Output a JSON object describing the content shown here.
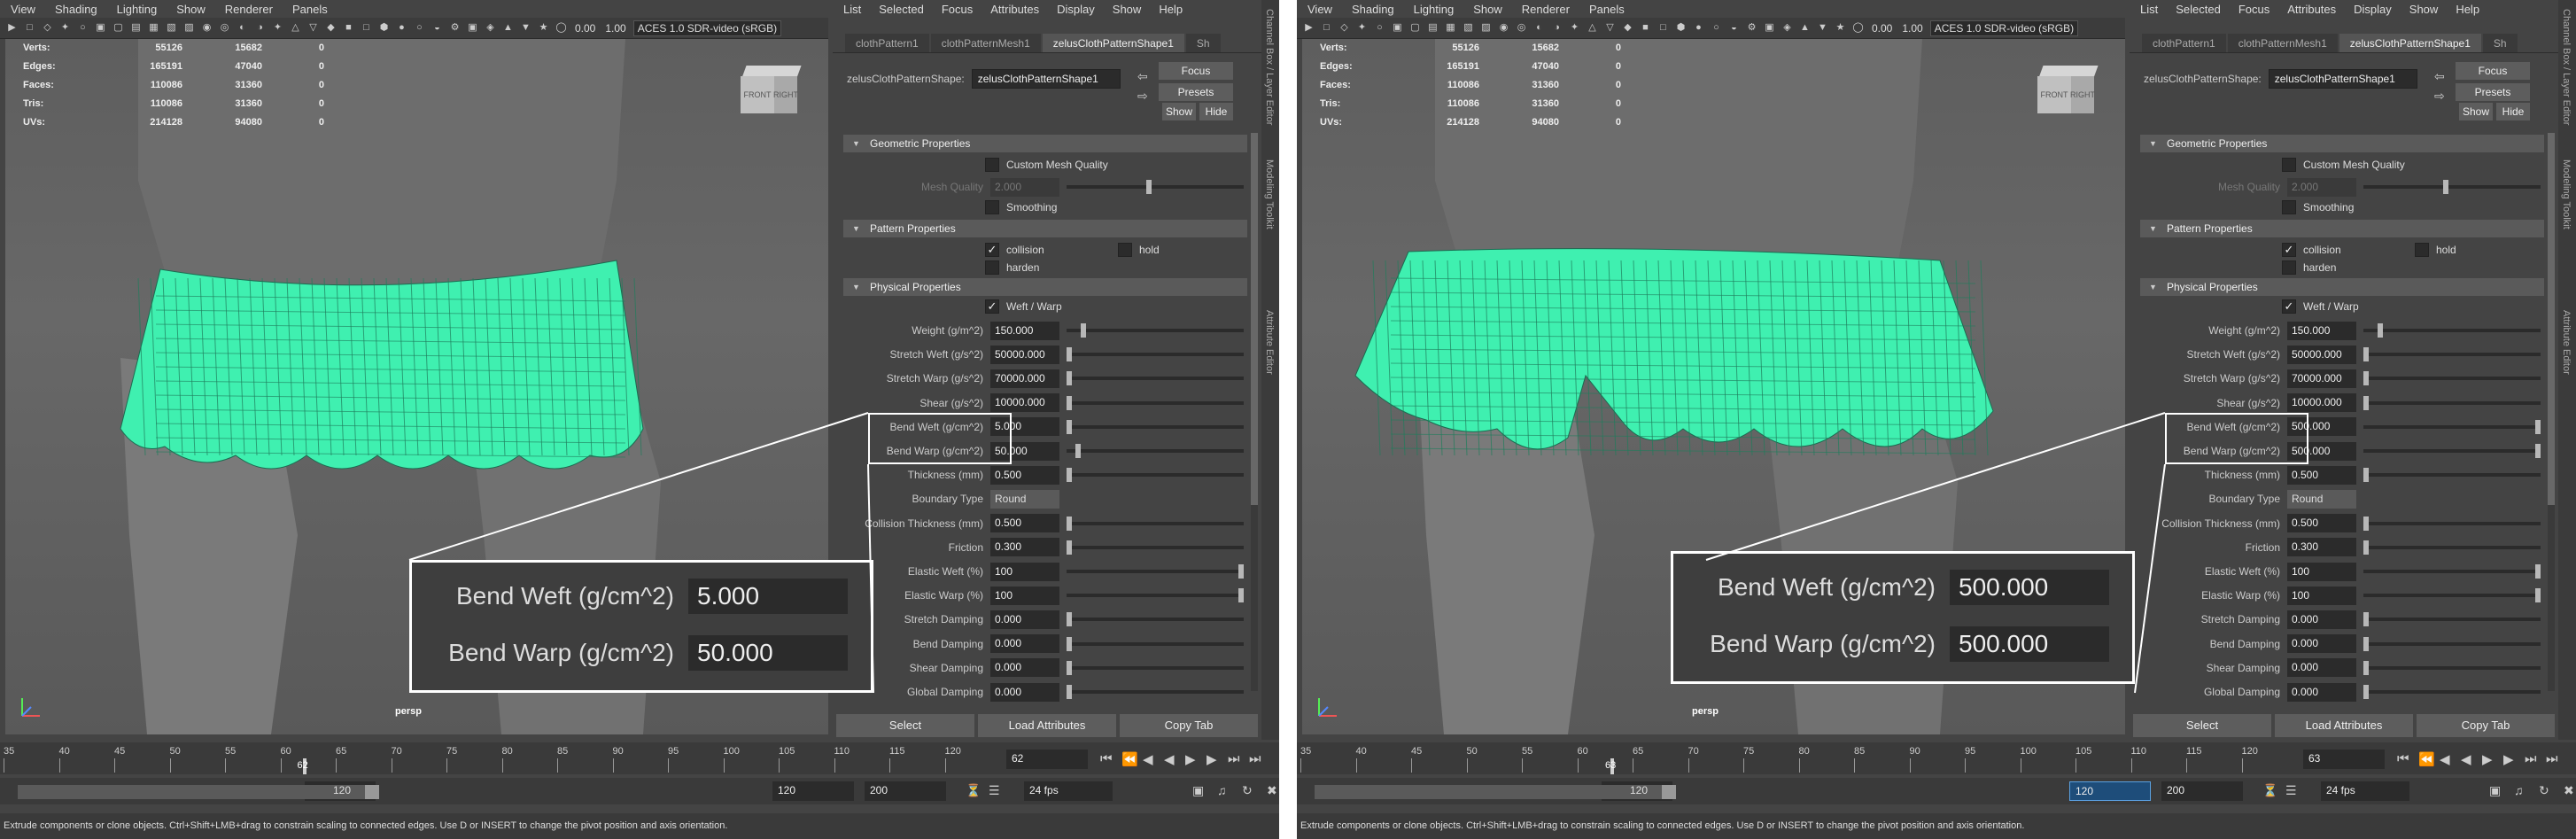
{
  "menubar": [
    "View",
    "Shading",
    "Lighting",
    "Show",
    "Renderer",
    "Panels"
  ],
  "toolbar": {
    "num1": "0.00",
    "num2": "1.00",
    "aces": "ACES 1.0 SDR-video (sRGB)"
  },
  "stats": [
    {
      "label": "Verts:",
      "v1": "55126",
      "v2": "15682",
      "v3": "0"
    },
    {
      "label": "Edges:",
      "v1": "165191",
      "v2": "47040",
      "v3": "0"
    },
    {
      "label": "Faces:",
      "v1": "110086",
      "v2": "31360",
      "v3": "0"
    },
    {
      "label": "Tris:",
      "v1": "110086",
      "v2": "31360",
      "v3": "0"
    },
    {
      "label": "UVs:",
      "v1": "214128",
      "v2": "94080",
      "v3": "0"
    }
  ],
  "viewcube": {
    "front": "FRONT",
    "right": "RIGHT"
  },
  "camera": "persp",
  "attr_menu": [
    "List",
    "Selected",
    "Focus",
    "Attributes",
    "Display",
    "Show",
    "Help"
  ],
  "tabs": [
    "clothPattern1",
    "clothPatternMesh1",
    "zelusClothPatternShape1",
    "Sh"
  ],
  "shape_label": "zelusClothPatternShape:",
  "shape_value": "zelusClothPatternShape1",
  "buttons": {
    "focus": "Focus",
    "presets": "Presets",
    "show": "Show",
    "hide": "Hide"
  },
  "sections": {
    "geometric": "Geometric Properties",
    "pattern": "Pattern Properties",
    "physical": "Physical Properties"
  },
  "geometric": {
    "custom_mesh": "Custom Mesh Quality",
    "mesh_quality_label": "Mesh Quality",
    "mesh_quality_value": "2.000",
    "smoothing": "Smoothing"
  },
  "pattern": {
    "collision": "collision",
    "hold": "hold",
    "harden": "harden"
  },
  "weft_warp": "Weft / Warp",
  "bottom_buttons": {
    "select": "Select",
    "load": "Load Attributes",
    "copy": "Copy Tab"
  },
  "side_tabs": [
    "Channel Box / Layer Editor",
    "Modeling Toolkit",
    "Attribute Editor"
  ],
  "timeline_ticks": [
    "35",
    "40",
    "45",
    "50",
    "55",
    "60",
    "65",
    "70",
    "75",
    "80",
    "85",
    "90",
    "95",
    "100",
    "105",
    "110",
    "115",
    "120"
  ],
  "range": {
    "start": "120",
    "end": "120",
    "end2": "200",
    "fps": "24 fps"
  },
  "help_text": "Extrude components or clone objects. Ctrl+Shift+LMB+drag to constrain scaling to connected edges. Use D or INSERT to change the pivot position and axis orientation.",
  "panels": [
    {
      "current_frame": "62",
      "frame_field": "62",
      "fields": [
        {
          "label": "Weight (g/m^2)",
          "value": "150.000",
          "pos": 0.08
        },
        {
          "label": "Stretch Weft (g/s^2)",
          "value": "50000.000",
          "pos": 0.0
        },
        {
          "label": "Stretch Warp (g/s^2)",
          "value": "70000.000",
          "pos": 0.0
        },
        {
          "label": "Shear (g/s^2)",
          "value": "10000.000",
          "pos": 0.0
        },
        {
          "label": "Bend Weft (g/cm^2)",
          "value": "5.000",
          "pos": 0.0
        },
        {
          "label": "Bend Warp (g/cm^2)",
          "value": "50.000",
          "pos": 0.05
        },
        {
          "label": "Thickness (mm)",
          "value": "0.500",
          "pos": 0.0
        },
        {
          "label": "Boundary Type",
          "value": "Round",
          "dropdown": true
        },
        {
          "label": "Collision Thickness (mm)",
          "value": "0.500",
          "pos": 0.0
        },
        {
          "label": "Friction",
          "value": "0.300",
          "pos": 0.0
        },
        {
          "label": "Elastic Weft (%)",
          "value": "100",
          "pos": 1.0
        },
        {
          "label": "Elastic Warp (%)",
          "value": "100",
          "pos": 1.0
        },
        {
          "label": "Stretch Damping",
          "value": "0.000",
          "pos": 0.0
        },
        {
          "label": "Bend Damping",
          "value": "0.000",
          "pos": 0.0
        },
        {
          "label": "Shear Damping",
          "value": "0.000",
          "pos": 0.0
        },
        {
          "label": "Global Damping",
          "value": "0.000",
          "pos": 0.0
        }
      ],
      "zoom": {
        "weft_label": "Bend Weft (g/cm^2)",
        "weft_value": "5.000",
        "warp_label": "Bend Warp (g/cm^2)",
        "warp_value": "50.000"
      },
      "range_start_field": "120"
    },
    {
      "current_frame": "63",
      "frame_field": "63",
      "fields": [
        {
          "label": "Weight (g/m^2)",
          "value": "150.000",
          "pos": 0.08
        },
        {
          "label": "Stretch Weft (g/s^2)",
          "value": "50000.000",
          "pos": 0.0
        },
        {
          "label": "Stretch Warp (g/s^2)",
          "value": "70000.000",
          "pos": 0.0
        },
        {
          "label": "Shear (g/s^2)",
          "value": "10000.000",
          "pos": 0.0
        },
        {
          "label": "Bend Weft (g/cm^2)",
          "value": "500.000",
          "pos": 1.0
        },
        {
          "label": "Bend Warp (g/cm^2)",
          "value": "500.000",
          "pos": 1.0
        },
        {
          "label": "Thickness (mm)",
          "value": "0.500",
          "pos": 0.0
        },
        {
          "label": "Boundary Type",
          "value": "Round",
          "dropdown": true
        },
        {
          "label": "Collision Thickness (mm)",
          "value": "0.500",
          "pos": 0.0
        },
        {
          "label": "Friction",
          "value": "0.300",
          "pos": 0.0
        },
        {
          "label": "Elastic Weft (%)",
          "value": "100",
          "pos": 1.0
        },
        {
          "label": "Elastic Warp (%)",
          "value": "100",
          "pos": 1.0
        },
        {
          "label": "Stretch Damping",
          "value": "0.000",
          "pos": 0.0
        },
        {
          "label": "Bend Damping",
          "value": "0.000",
          "pos": 0.0
        },
        {
          "label": "Shear Damping",
          "value": "0.000",
          "pos": 0.0
        },
        {
          "label": "Global Damping",
          "value": "0.000",
          "pos": 0.0
        }
      ],
      "zoom": {
        "weft_label": "Bend Weft (g/cm^2)",
        "weft_value": "500.000",
        "warp_label": "Bend Warp (g/cm^2)",
        "warp_value": "500.000"
      },
      "range_start_field": "120"
    }
  ],
  "colors": {
    "mesh": "#3ff0b0",
    "bg": "#444444",
    "viewport": "#626262"
  }
}
